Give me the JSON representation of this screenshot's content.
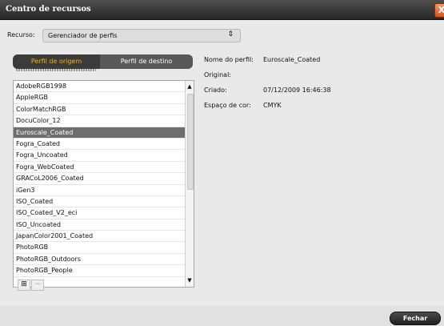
{
  "window": {
    "title": "Centro de recursos",
    "close_glyph": "X"
  },
  "resource": {
    "label": "Recurso:",
    "selected": "Gerenciador de perfis",
    "arrows": "⇕"
  },
  "tabs": [
    {
      "label": "Perfil de origem"
    },
    {
      "label": "Perfil de destino"
    }
  ],
  "profiles": [
    "AdobeRGB1998",
    "AppleRGB",
    "ColorMatchRGB",
    "DocuColor_12",
    "Euroscale_Coated",
    "Fogra_Coated",
    "Fogra_Uncoated",
    "Fogra_WebCoated",
    "GRACoL2006_Coated",
    "iGen3",
    "ISO_Coated",
    "ISO_Coated_V2_eci",
    "ISO_Uncoated",
    "JapanColor2001_Coated",
    "PhotoRGB",
    "PhotoRGB_Outdoors",
    "PhotoRGB_People"
  ],
  "selected_profile": "Euroscale_Coated",
  "details": [
    {
      "label": "Nome do perfil:",
      "value": "Euroscale_Coated"
    },
    {
      "label": "Original:",
      "value": ""
    },
    {
      "label": "Criado:",
      "value": "07/12/2009 16:46:38"
    },
    {
      "label": "Espaço de cor:",
      "value": "CMYK"
    }
  ],
  "list_actions": {
    "add_glyph": "⊞",
    "remove_glyph": "−"
  },
  "footer": {
    "close_label": "Fechar"
  },
  "scroll": {
    "up": "▲",
    "down": "▼"
  },
  "colors": {
    "active_tab_text": "#f6b000",
    "titlebar": "#3a3a3a",
    "selected_row": "#6e6e6e"
  }
}
